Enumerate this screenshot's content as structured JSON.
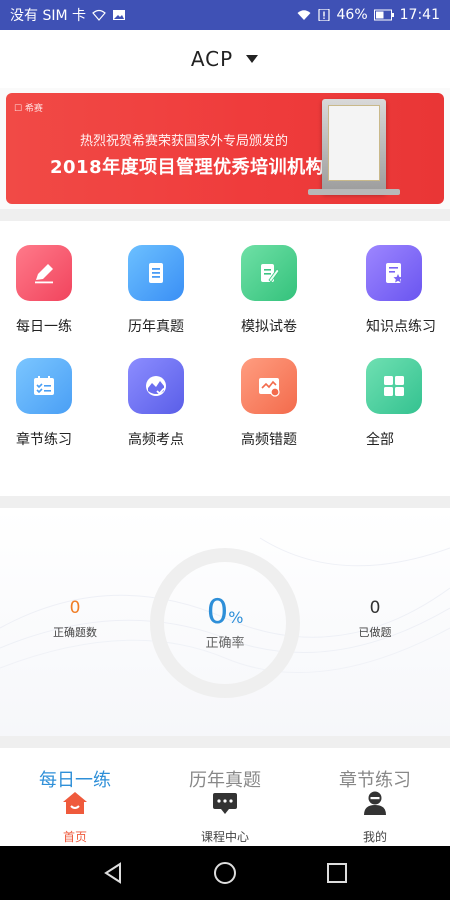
{
  "status_bar": {
    "carrier": "没有 SIM 卡",
    "battery": "46%",
    "time": "17:41"
  },
  "header": {
    "title": "ACP",
    "caret_icon": "triangle-down-icon"
  },
  "banner": {
    "brand": "☐ 希赛",
    "line1": "热烈祝贺希赛荣获国家外专局颁发的",
    "line2": "2018年度项目管理优秀培训机构",
    "plaque_icon": "award-plaque-icon",
    "colors": {
      "start": "#f14a46",
      "end": "#e93636"
    }
  },
  "grid": {
    "items": [
      {
        "label": "每日一练",
        "icon": "pencil-icon",
        "color_from": "#ff7a8a",
        "color_to": "#f1445d"
      },
      {
        "label": "历年真题",
        "icon": "document-icon",
        "color_from": "#6cc0ff",
        "color_to": "#3a8ff5"
      },
      {
        "label": "模拟试卷",
        "icon": "edit-paper-icon",
        "color_from": "#6fe0a6",
        "color_to": "#34c27c"
      },
      {
        "label": "知识点练习",
        "icon": "star-note-icon",
        "color_from": "#9d86ff",
        "color_to": "#6a55f0"
      },
      {
        "label": "章节练习",
        "icon": "checklist-icon",
        "color_from": "#7bc6ff",
        "color_to": "#4a9ff5"
      },
      {
        "label": "高频考点",
        "icon": "gauge-check-icon",
        "color_from": "#8c8dff",
        "color_to": "#5a5ee8"
      },
      {
        "label": "高频错题",
        "icon": "chart-error-icon",
        "color_from": "#ff9d80",
        "color_to": "#f36b4c"
      },
      {
        "label": "全部",
        "icon": "grid-four-icon",
        "color_from": "#6fe0b2",
        "color_to": "#34c290"
      }
    ]
  },
  "stats": {
    "correct_count": "0",
    "correct_count_label": "正确题数",
    "rate_value": "0",
    "rate_unit": "%",
    "rate_label": "正确率",
    "done_count": "0",
    "done_count_label": "已做题"
  },
  "tabbar": {
    "tabs": [
      {
        "top_label": "每日一练",
        "bottom_label": "首页",
        "icon": "home-icon",
        "active": true
      },
      {
        "top_label": "历年真题",
        "bottom_label": "课程中心",
        "icon": "chat-bubble-icon",
        "active": false
      },
      {
        "top_label": "章节练习",
        "bottom_label": "我的",
        "icon": "person-icon",
        "active": false
      }
    ],
    "active_color": "#2e8fd8",
    "active_icon_color": "#ef5a3c"
  },
  "navbar": {
    "buttons": [
      "back-icon",
      "home-circle-icon",
      "recents-icon"
    ]
  }
}
